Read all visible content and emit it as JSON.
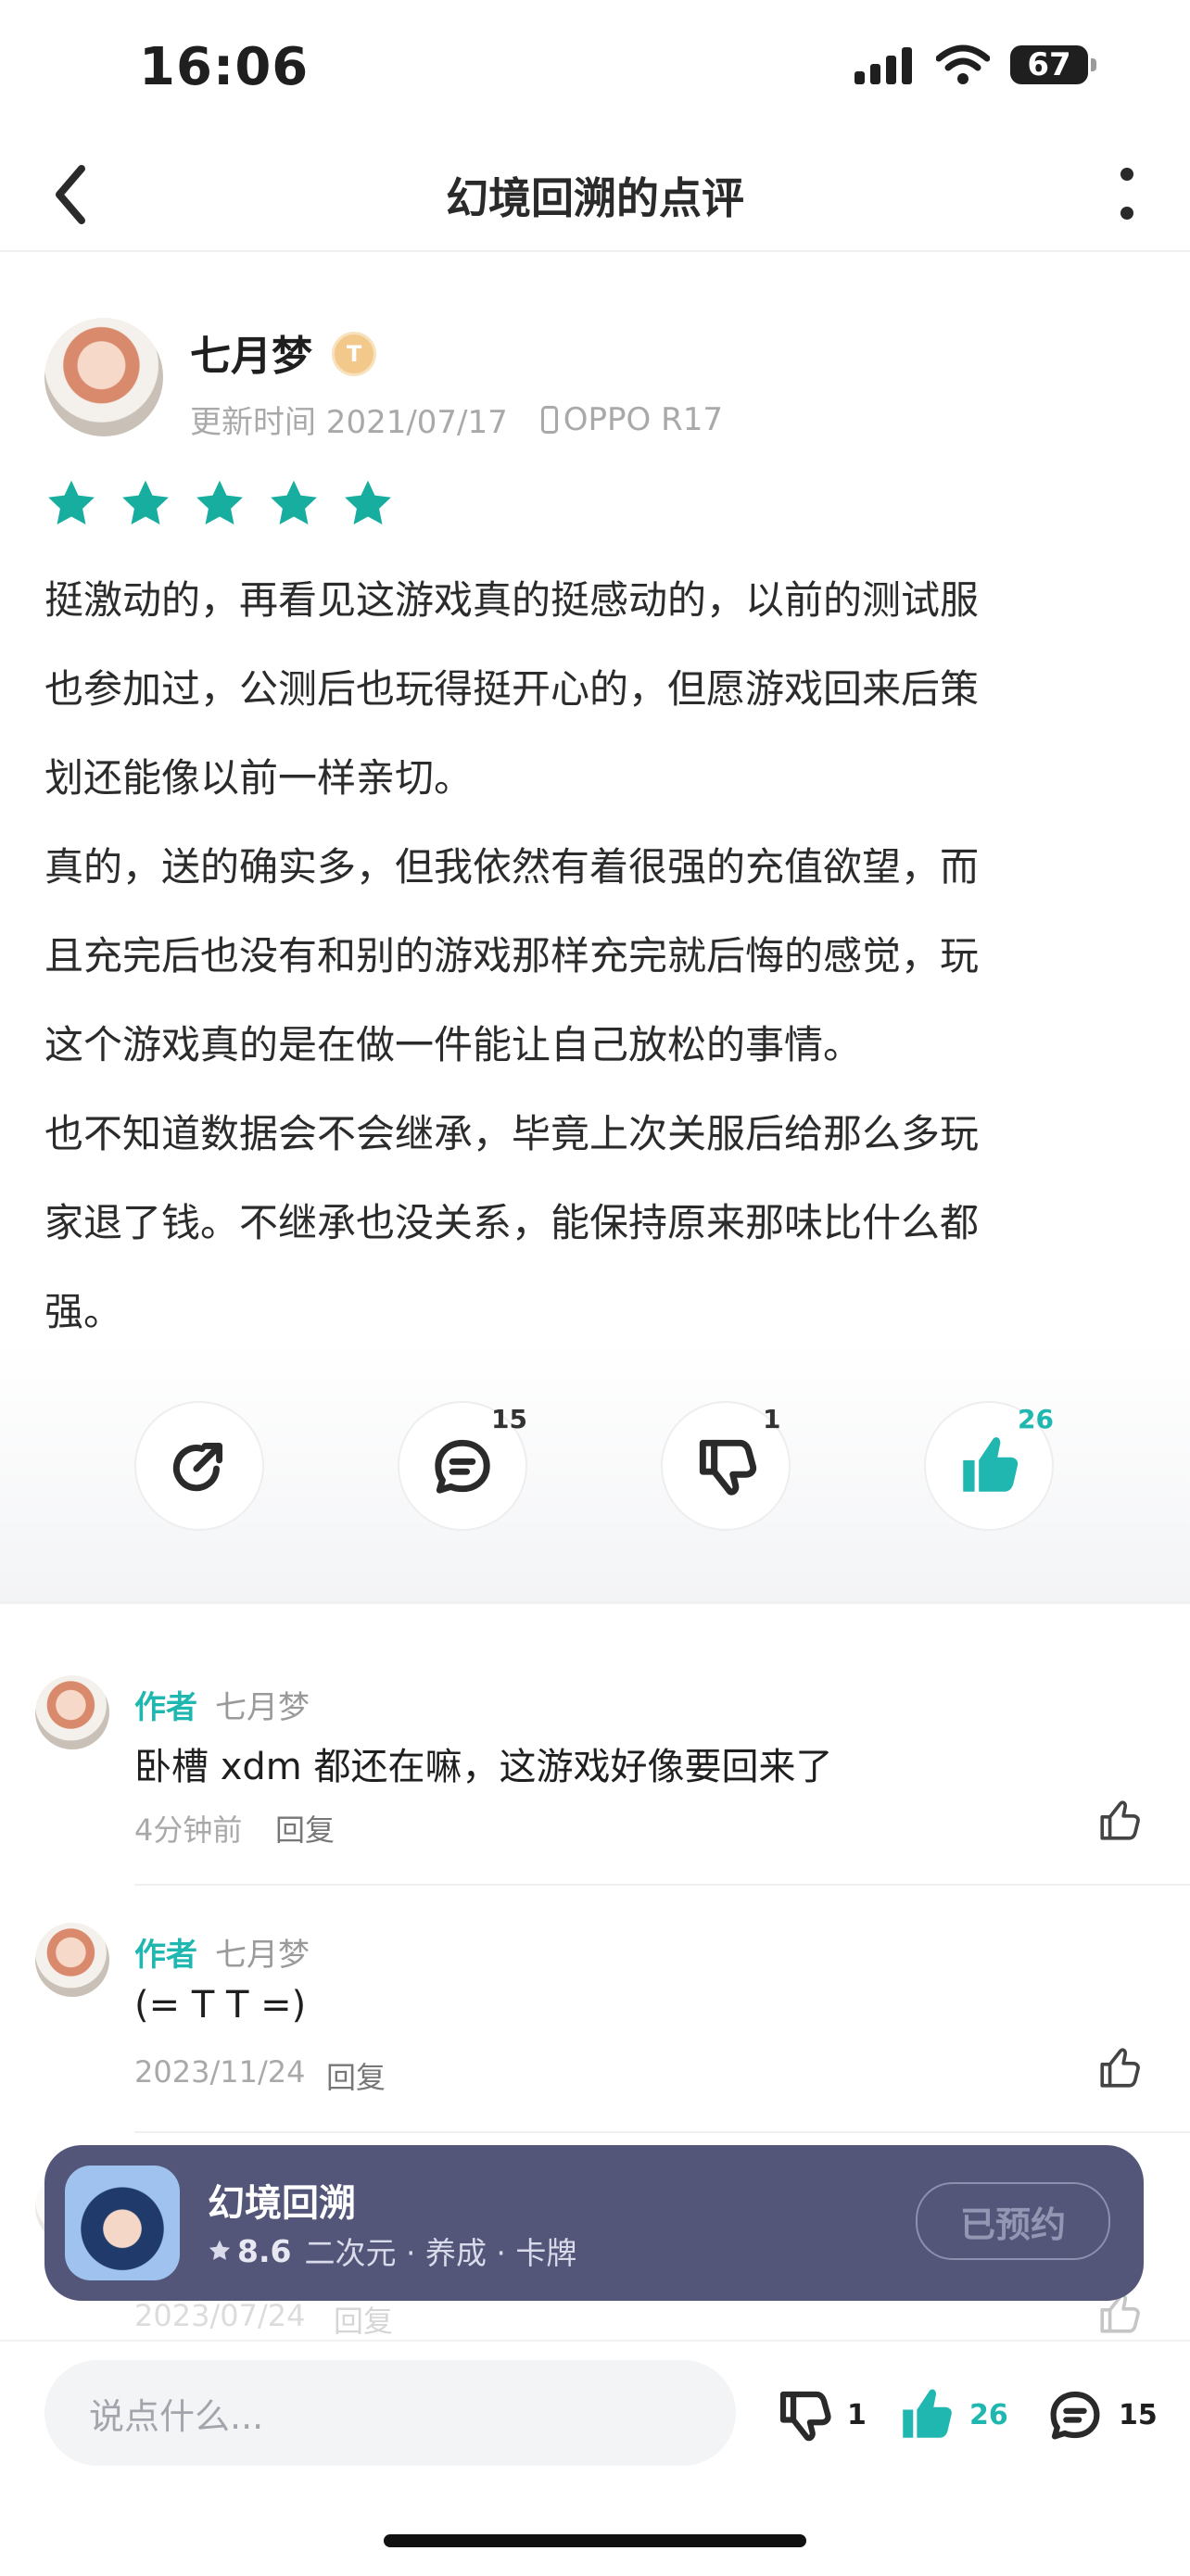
{
  "status_bar": {
    "time": "16:06",
    "battery": "67"
  },
  "nav": {
    "title": "幻境回溯的点评"
  },
  "review": {
    "author": "七月梦",
    "level_badge": "T",
    "updated": "更新时间 2021/07/17",
    "device": "OPPO R17",
    "rating": 5,
    "paragraphs": [
      "挺激动的，再看见这游戏真的挺感动的，以前的测试服",
      "也参加过，公测后也玩得挺开心的，但愿游戏回来后策",
      "划还能像以前一样亲切。",
      "真的，送的确实多，但我依然有着很强的充值欲望，而",
      "且充完后也没有和别的游戏那样充完就后悔的感觉，玩",
      "这个游戏真的是在做一件能让自己放松的事情。",
      "也不知道数据会不会继承，毕竟上次关服后给那么多玩",
      "家退了钱。不继承也没关系，能保持原来那味比什么都",
      "强。"
    ],
    "actions": {
      "comments": "15",
      "dislikes": "1",
      "likes": "26"
    }
  },
  "comments": [
    {
      "tag": "作者",
      "name": "七月梦",
      "text": "卧槽 xdm 都还在嘛，这游戏好像要回来了",
      "time": "4分钟前",
      "reply": "回复"
    },
    {
      "tag": "作者",
      "name": "七月梦",
      "text": "(= T T =)",
      "time": "2023/11/24",
      "reply": "回复"
    },
    {
      "time": "2023/07/24",
      "reply": "回复"
    }
  ],
  "game_card": {
    "name": "幻境回溯",
    "score": "8.6",
    "tags": "二次元 · 养成 · 卡牌",
    "button": "已预约"
  },
  "bottom_bar": {
    "placeholder": "说点什么...",
    "dislikes": "1",
    "likes": "26",
    "comments": "15"
  },
  "colors": {
    "accent": "#1fb7b0",
    "star": "#17ad9f",
    "card_bg": "#535678"
  },
  "icons": [
    "back-icon",
    "more-icon",
    "share-icon",
    "comment-icon",
    "dislike-icon",
    "like-icon",
    "device-icon",
    "star-icon"
  ]
}
